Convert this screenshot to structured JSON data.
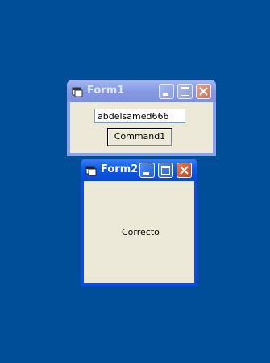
{
  "colors": {
    "desktop": "#004e98",
    "client_bg": "#ece9d8"
  },
  "form1": {
    "title": "Form1",
    "icon": "form-window-icon",
    "textbox_value": "abdelsamed666",
    "button_label": "Command1",
    "controls": [
      "minimize-icon",
      "maximize-icon",
      "close-icon"
    ]
  },
  "form2": {
    "title": "Form2",
    "icon": "form-window-icon",
    "label_text": "Correcto",
    "controls": [
      "minimize-icon",
      "maximize-icon",
      "close-icon"
    ]
  }
}
